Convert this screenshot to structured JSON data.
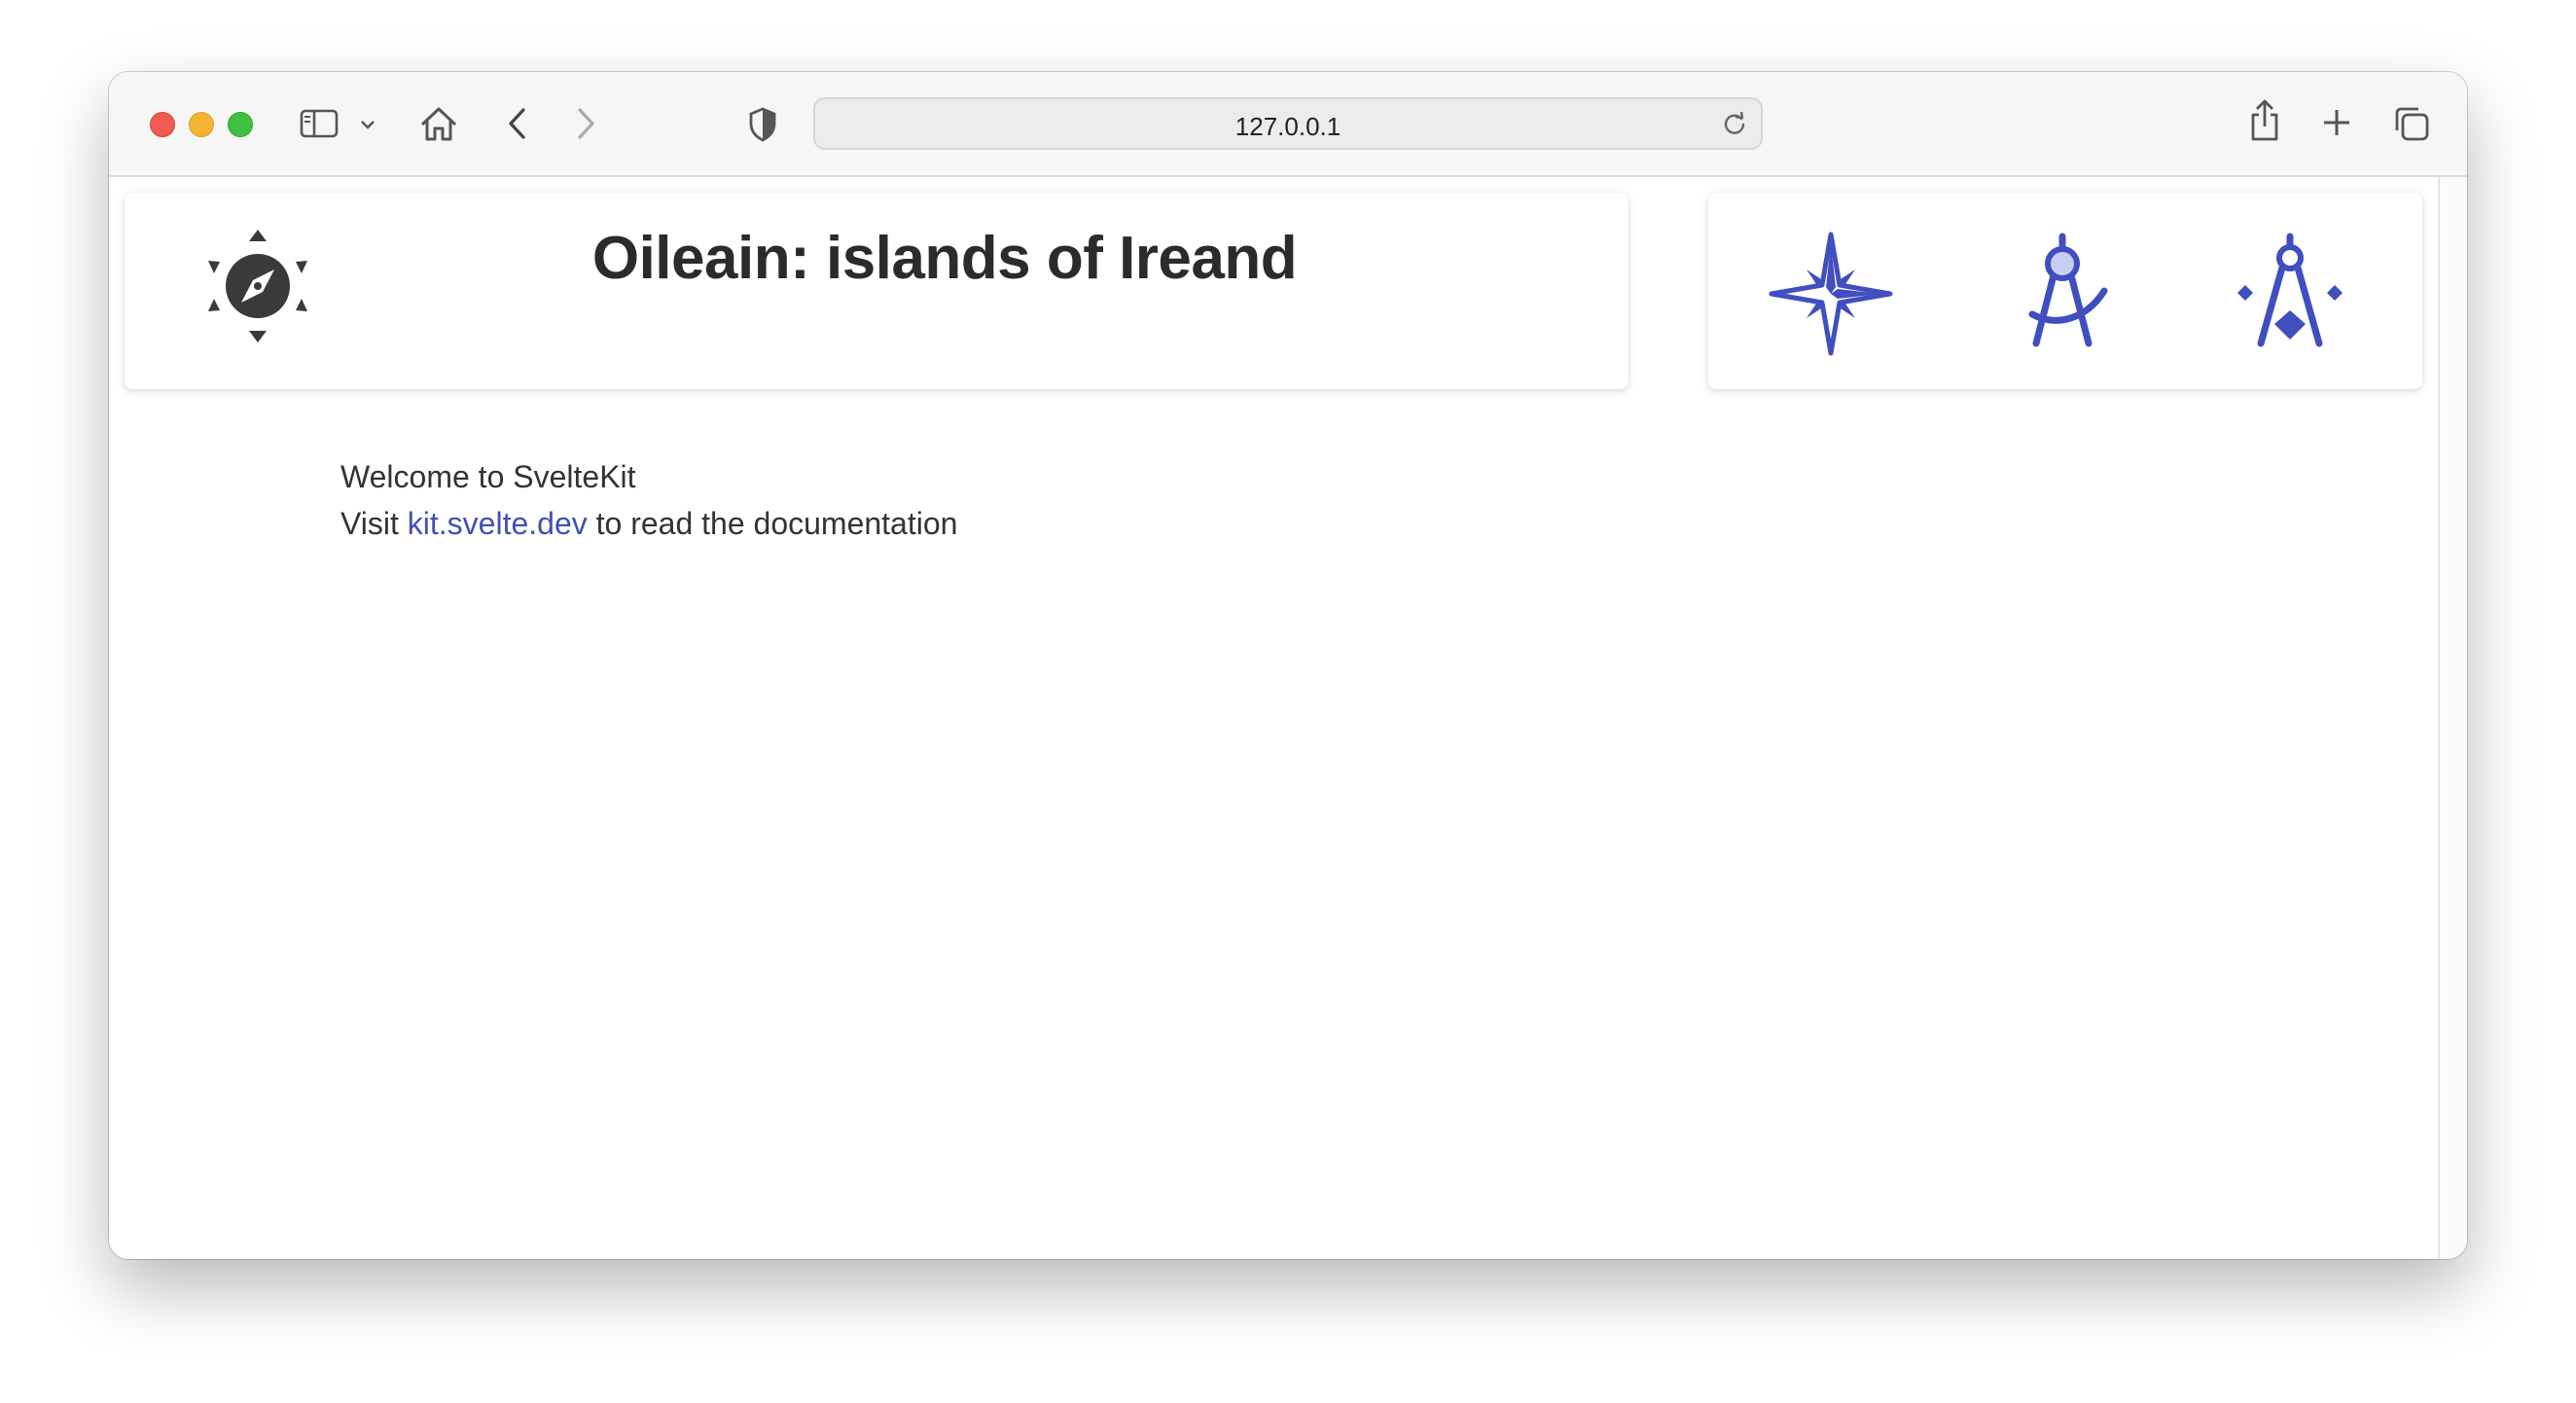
{
  "browser": {
    "url": "127.0.0.1",
    "traffic_lights": {
      "close": "#ee5b52",
      "minimize": "#f2b532",
      "maximize": "#3fc03e"
    },
    "icons": [
      "sidebar-icon",
      "chevron-down-icon",
      "home-icon",
      "back-icon",
      "forward-icon",
      "shield-icon",
      "reload-icon",
      "share-icon",
      "plus-icon",
      "tabs-icon"
    ]
  },
  "header": {
    "title": "Oileain: islands of Ireand",
    "logo_icon": "compass-sun-icon"
  },
  "nav": {
    "items": [
      {
        "icon": "compass-rose-icon"
      },
      {
        "icon": "drawing-compass-icon"
      },
      {
        "icon": "compass-tools-icon"
      }
    ],
    "accent_color": "#3f4fbf"
  },
  "main": {
    "welcome": "Welcome to SvelteKit",
    "visit_prefix": "Visit",
    "link_text": "kit.svelte.dev",
    "visit_suffix": "to read the documentation"
  }
}
